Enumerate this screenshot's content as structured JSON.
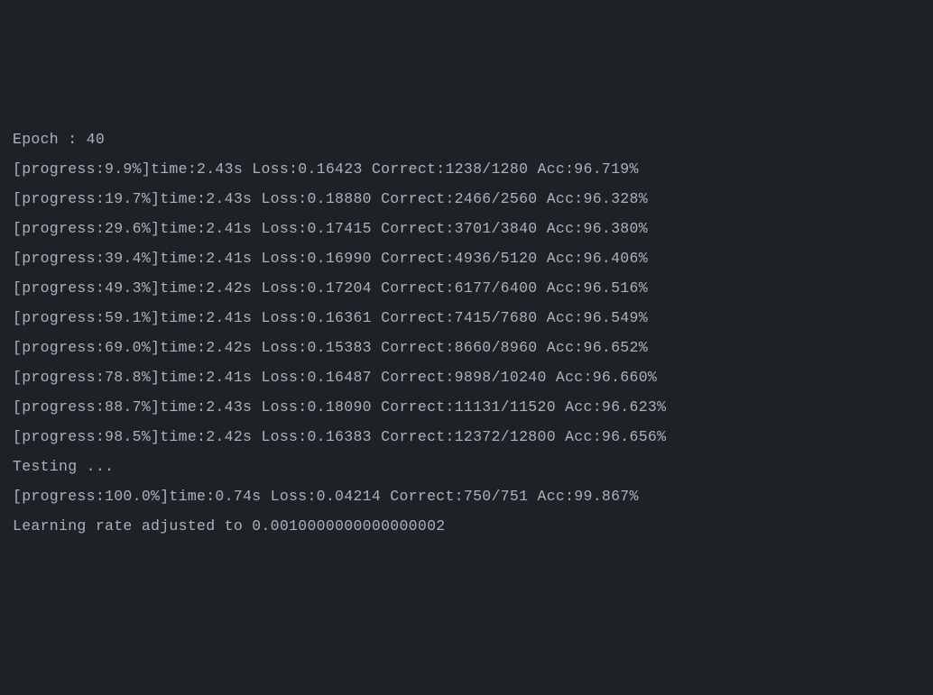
{
  "terminal": {
    "epoch_line": "Epoch : 40",
    "training_lines": [
      "[progress:9.9%]time:2.43s Loss:0.16423 Correct:1238/1280 Acc:96.719%",
      "[progress:19.7%]time:2.43s Loss:0.18880 Correct:2466/2560 Acc:96.328%",
      "[progress:29.6%]time:2.41s Loss:0.17415 Correct:3701/3840 Acc:96.380%",
      "[progress:39.4%]time:2.41s Loss:0.16990 Correct:4936/5120 Acc:96.406%",
      "[progress:49.3%]time:2.42s Loss:0.17204 Correct:6177/6400 Acc:96.516%",
      "[progress:59.1%]time:2.41s Loss:0.16361 Correct:7415/7680 Acc:96.549%",
      "[progress:69.0%]time:2.42s Loss:0.15383 Correct:8660/8960 Acc:96.652%",
      "[progress:78.8%]time:2.41s Loss:0.16487 Correct:9898/10240 Acc:96.660%",
      "[progress:88.7%]time:2.43s Loss:0.18090 Correct:11131/11520 Acc:96.623%",
      "[progress:98.5%]time:2.42s Loss:0.16383 Correct:12372/12800 Acc:96.656%"
    ],
    "testing_line": "Testing ...",
    "test_progress_line": "[progress:100.0%]time:0.74s Loss:0.04214 Correct:750/751 Acc:99.867%",
    "lr_line": "Learning rate adjusted to 0.0010000000000000002"
  }
}
